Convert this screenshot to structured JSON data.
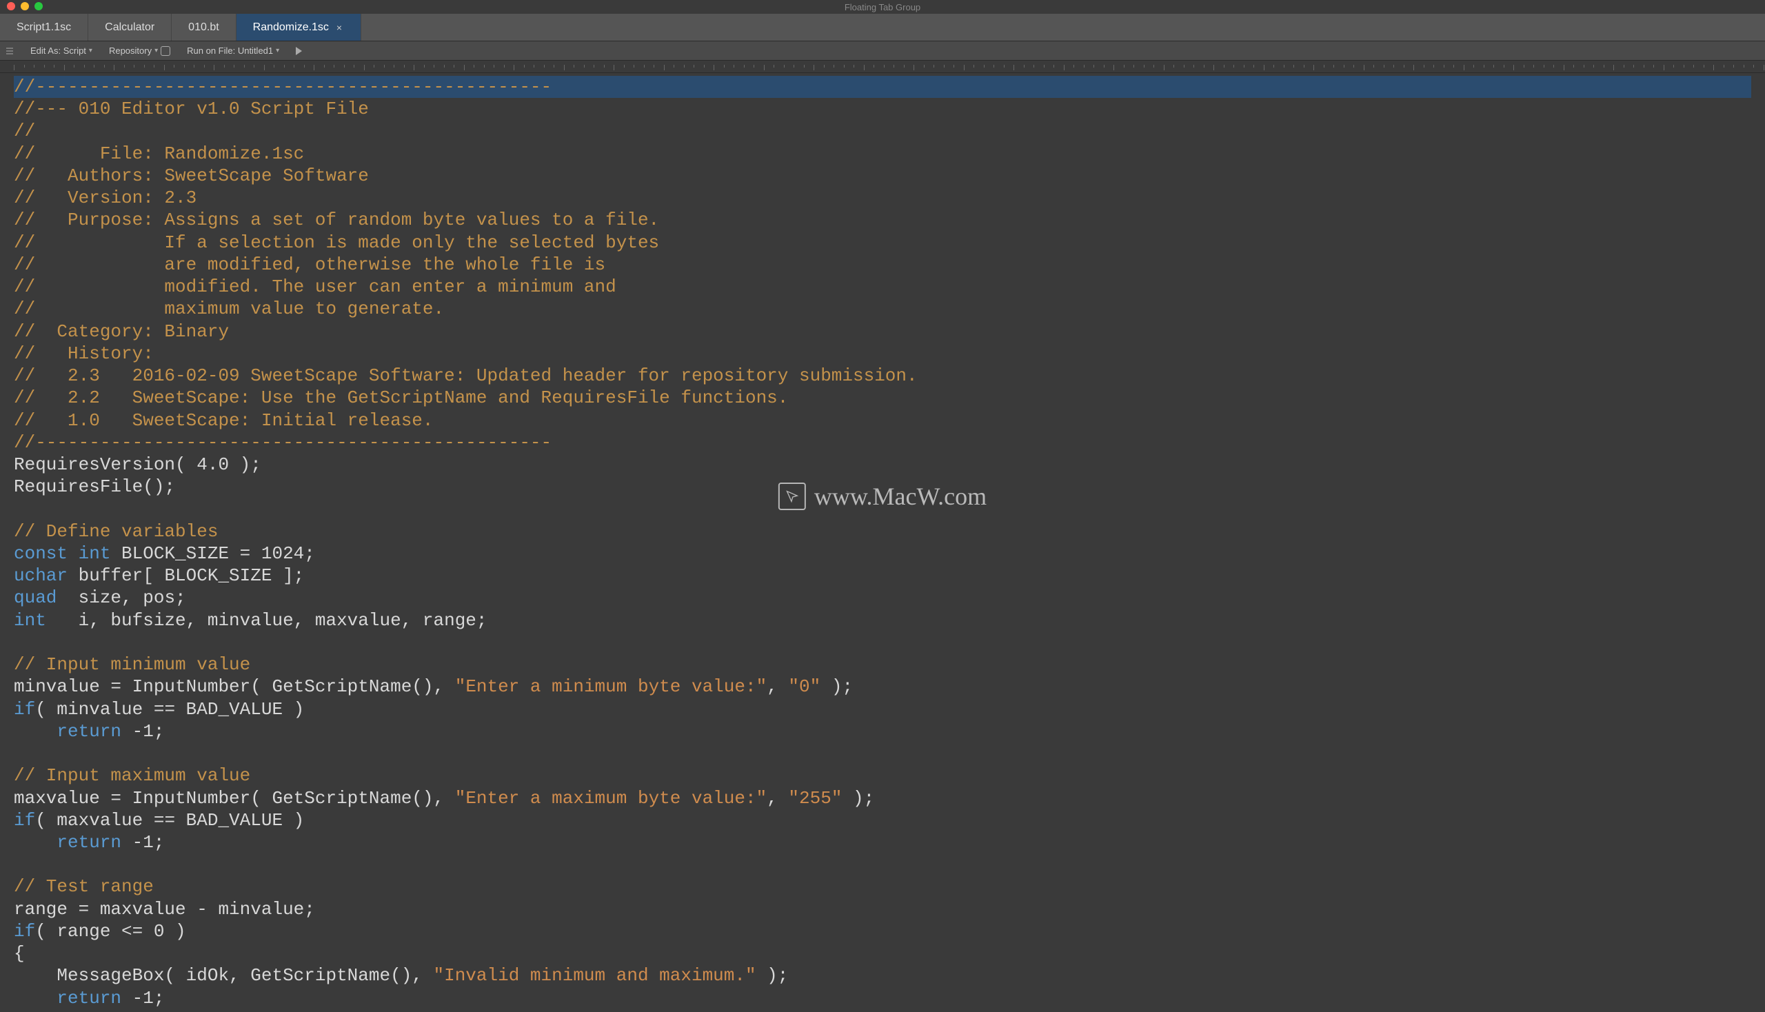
{
  "window": {
    "title": "Floating Tab Group"
  },
  "tabs": [
    {
      "label": "Script1.1sc",
      "active": false
    },
    {
      "label": "Calculator",
      "active": false
    },
    {
      "label": "010.bt",
      "active": false
    },
    {
      "label": "Randomize.1sc",
      "active": true
    }
  ],
  "toolbar": {
    "edit_as": "Edit As: Script",
    "repository": "Repository",
    "run_on": "Run on File: Untitled1"
  },
  "watermark": "www.MacW.com",
  "code": [
    {
      "tokens": [
        [
          "comment",
          "//------------------------------------------------"
        ]
      ],
      "highlight": true
    },
    {
      "tokens": [
        [
          "comment",
          "//--- 010 Editor v1.0 Script File"
        ]
      ]
    },
    {
      "tokens": [
        [
          "comment",
          "//"
        ]
      ]
    },
    {
      "tokens": [
        [
          "comment",
          "//      File: Randomize.1sc"
        ]
      ]
    },
    {
      "tokens": [
        [
          "comment",
          "//   Authors: SweetScape Software"
        ]
      ]
    },
    {
      "tokens": [
        [
          "comment",
          "//   Version: 2.3"
        ]
      ]
    },
    {
      "tokens": [
        [
          "comment",
          "//   Purpose: Assigns a set of random byte values to a file. "
        ]
      ]
    },
    {
      "tokens": [
        [
          "comment",
          "//            If a selection is made only the selected bytes"
        ]
      ]
    },
    {
      "tokens": [
        [
          "comment",
          "//            are modified, otherwise the whole file is "
        ]
      ]
    },
    {
      "tokens": [
        [
          "comment",
          "//            modified. The user can enter a minimum and "
        ]
      ]
    },
    {
      "tokens": [
        [
          "comment",
          "//            maximum value to generate."
        ]
      ]
    },
    {
      "tokens": [
        [
          "comment",
          "//  Category: Binary"
        ]
      ]
    },
    {
      "tokens": [
        [
          "comment",
          "//   History: "
        ]
      ]
    },
    {
      "tokens": [
        [
          "comment",
          "//   2.3   2016-02-09 SweetScape Software: Updated header for repository submission."
        ]
      ]
    },
    {
      "tokens": [
        [
          "comment",
          "//   2.2   SweetScape: Use the GetScriptName and RequiresFile functions."
        ]
      ]
    },
    {
      "tokens": [
        [
          "comment",
          "//   1.0   SweetScape: Initial release."
        ]
      ]
    },
    {
      "tokens": [
        [
          "comment",
          "//------------------------------------------------"
        ]
      ]
    },
    {
      "tokens": [
        [
          "txt",
          "RequiresVersion( 4.0 );"
        ]
      ]
    },
    {
      "tokens": [
        [
          "txt",
          "RequiresFile();"
        ]
      ]
    },
    {
      "tokens": [
        [
          "txt",
          ""
        ]
      ]
    },
    {
      "tokens": [
        [
          "comment",
          "// Define variables"
        ]
      ]
    },
    {
      "tokens": [
        [
          "key",
          "const int"
        ],
        [
          "txt",
          " BLOCK_SIZE = 1024;"
        ]
      ]
    },
    {
      "tokens": [
        [
          "key",
          "uchar"
        ],
        [
          "txt",
          " buffer[ BLOCK_SIZE ];"
        ]
      ]
    },
    {
      "tokens": [
        [
          "key",
          "quad"
        ],
        [
          "txt",
          "  size, pos;"
        ]
      ]
    },
    {
      "tokens": [
        [
          "key",
          "int"
        ],
        [
          "txt",
          "   i, bufsize, minvalue, maxvalue, range;"
        ]
      ]
    },
    {
      "tokens": [
        [
          "txt",
          ""
        ]
      ]
    },
    {
      "tokens": [
        [
          "comment",
          "// Input minimum value"
        ]
      ]
    },
    {
      "tokens": [
        [
          "txt",
          "minvalue = InputNumber( GetScriptName(), "
        ],
        [
          "str",
          "\"Enter a minimum byte value:\""
        ],
        [
          "txt",
          ", "
        ],
        [
          "str",
          "\"0\""
        ],
        [
          "txt",
          " );"
        ]
      ]
    },
    {
      "tokens": [
        [
          "key",
          "if"
        ],
        [
          "txt",
          "( minvalue == BAD_VALUE )"
        ]
      ]
    },
    {
      "tokens": [
        [
          "txt",
          "    "
        ],
        [
          "key",
          "return"
        ],
        [
          "txt",
          " -1;"
        ]
      ]
    },
    {
      "tokens": [
        [
          "txt",
          ""
        ]
      ]
    },
    {
      "tokens": [
        [
          "comment",
          "// Input maximum value"
        ]
      ]
    },
    {
      "tokens": [
        [
          "txt",
          "maxvalue = InputNumber( GetScriptName(), "
        ],
        [
          "str",
          "\"Enter a maximum byte value:\""
        ],
        [
          "txt",
          ", "
        ],
        [
          "str",
          "\"255\""
        ],
        [
          "txt",
          " );"
        ]
      ]
    },
    {
      "tokens": [
        [
          "key",
          "if"
        ],
        [
          "txt",
          "( maxvalue == BAD_VALUE )"
        ]
      ]
    },
    {
      "tokens": [
        [
          "txt",
          "    "
        ],
        [
          "key",
          "return"
        ],
        [
          "txt",
          " -1;"
        ]
      ]
    },
    {
      "tokens": [
        [
          "txt",
          ""
        ]
      ]
    },
    {
      "tokens": [
        [
          "comment",
          "// Test range"
        ]
      ]
    },
    {
      "tokens": [
        [
          "txt",
          "range = maxvalue - minvalue;"
        ]
      ]
    },
    {
      "tokens": [
        [
          "key",
          "if"
        ],
        [
          "txt",
          "( range <= 0 )"
        ]
      ]
    },
    {
      "tokens": [
        [
          "txt",
          "{"
        ]
      ]
    },
    {
      "tokens": [
        [
          "txt",
          "    MessageBox( idOk, GetScriptName(), "
        ],
        [
          "str",
          "\"Invalid minimum and maximum.\""
        ],
        [
          "txt",
          " );"
        ]
      ]
    },
    {
      "tokens": [
        [
          "txt",
          "    "
        ],
        [
          "key",
          "return"
        ],
        [
          "txt",
          " -1;"
        ]
      ]
    }
  ]
}
